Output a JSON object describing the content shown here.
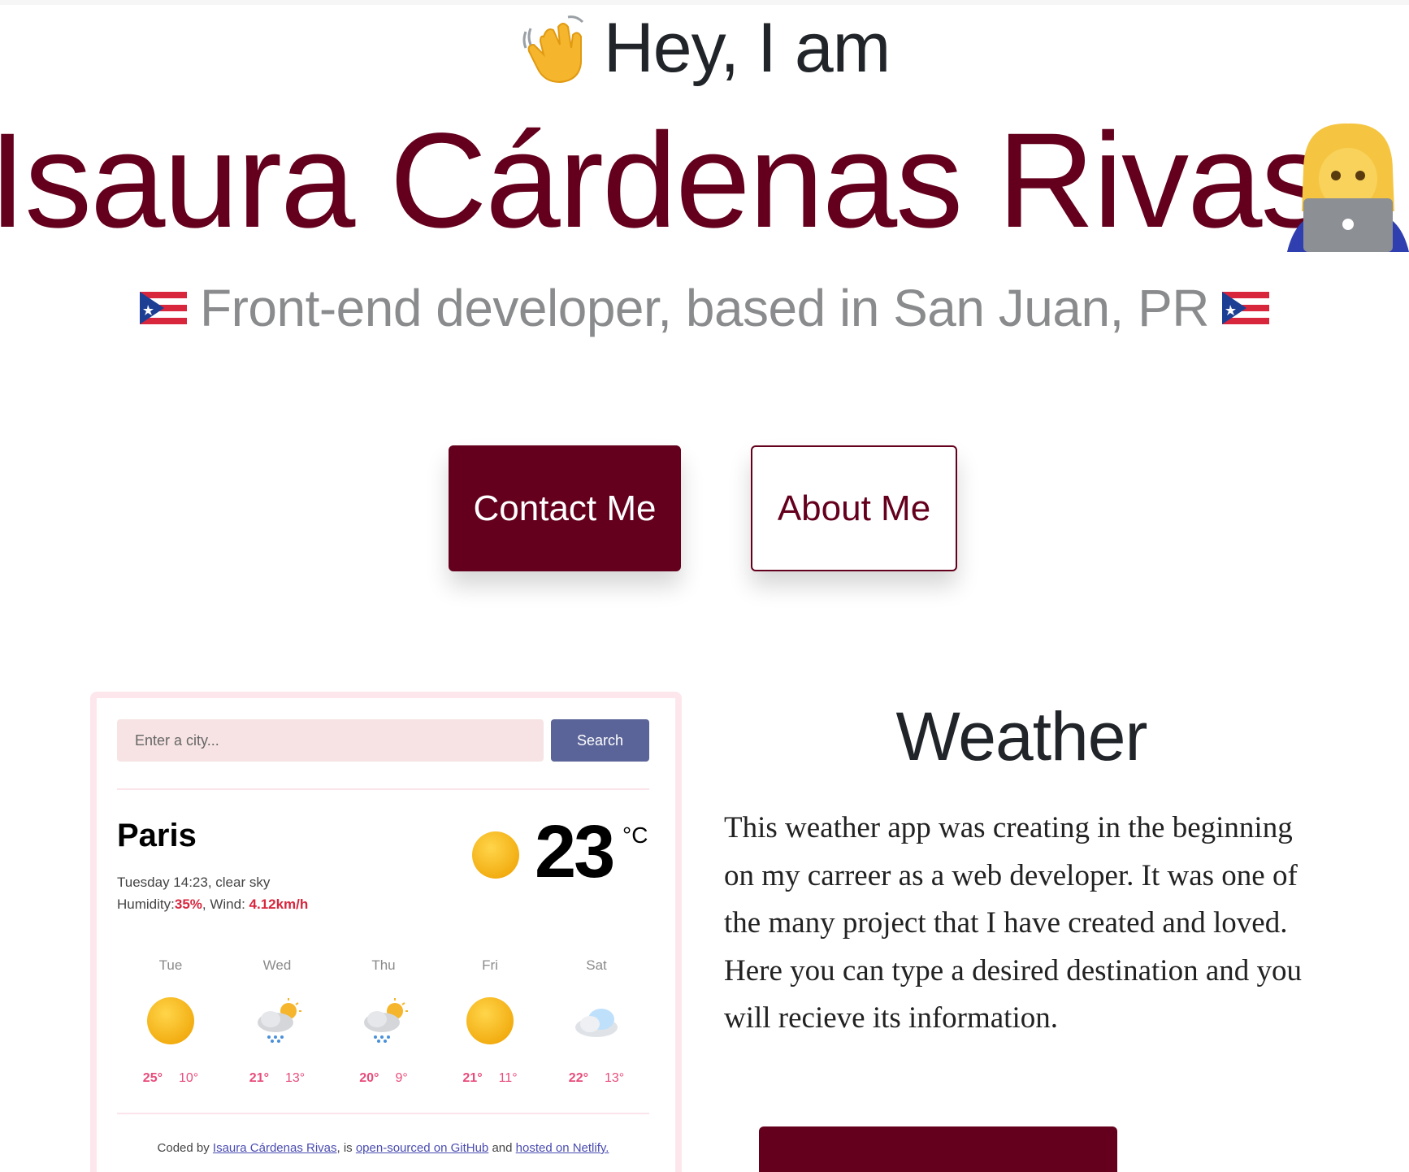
{
  "hero": {
    "greeting": "Hey, I am",
    "wave_icon": "waving-hand-icon",
    "name": "Isaura Cárdenas Rivas",
    "laptop_icon": "woman-technologist-icon",
    "subtitle": "Front-end developer, based in San Juan, PR",
    "flag_icon": "puerto-rico-flag-icon"
  },
  "buttons": {
    "contact": "Contact Me",
    "about": "About Me"
  },
  "colors": {
    "brand": "#64001d",
    "search_button": "#5a6498",
    "input_bg": "#f7e3e3",
    "highlight": "#d8263d",
    "forecast_temp": "#e84c7b"
  },
  "weather_app": {
    "search": {
      "placeholder": "Enter a city...",
      "button": "Search"
    },
    "city": "Paris",
    "datetime_desc": "Tuesday 14:23, clear sky",
    "humidity_label": "Humidity:",
    "humidity": "35%",
    "wind_label": ", Wind: ",
    "wind": "4.12km/h",
    "temperature": "23",
    "unit": "°C",
    "current_icon": "sun-icon",
    "forecast": [
      {
        "day": "Tue",
        "icon": "sun-icon",
        "max": "25°",
        "min": "10°"
      },
      {
        "day": "Wed",
        "icon": "rain-cloud-sun-icon",
        "max": "21°",
        "min": "13°"
      },
      {
        "day": "Thu",
        "icon": "rain-cloud-sun-icon",
        "max": "20°",
        "min": "9°"
      },
      {
        "day": "Fri",
        "icon": "sun-icon",
        "max": "21°",
        "min": "11°"
      },
      {
        "day": "Sat",
        "icon": "cloud-icon",
        "max": "22°",
        "min": "13°"
      }
    ],
    "footer": {
      "prefix": "Coded by ",
      "author_link": "Isaura Cárdenas Rivas",
      "middle": ", is ",
      "github_link": "open-sourced on GitHub",
      "and": " and ",
      "netlify_link": "hosted on Netlify."
    }
  },
  "project": {
    "title": "Weather",
    "description": "This weather app was creating in the beginning on my carreer as a web developer. It was one of the many project that I have created and loved. Here you can type a desired destination and you will recieve its information."
  }
}
